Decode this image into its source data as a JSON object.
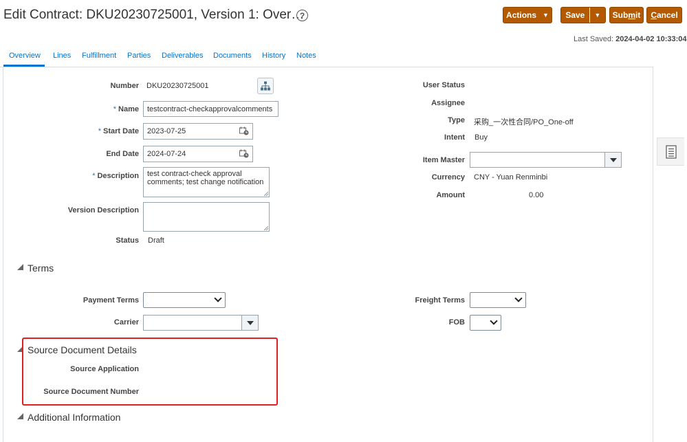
{
  "header": {
    "title": "Edit Contract: DKU20230725001, Version 1: Over…",
    "help_glyph": "?",
    "actions_label": "Actions",
    "save_label": "Save",
    "submit_prefix": "Sub",
    "submit_underlined": "m",
    "submit_suffix": "it",
    "cancel_underlined": "C",
    "cancel_suffix": "ancel",
    "last_saved_label": "Last Saved:",
    "last_saved_value": "2024-04-02 10:33:04",
    "button_color": "#b35900"
  },
  "tabs": [
    {
      "label": "Overview",
      "active": true
    },
    {
      "label": "Lines"
    },
    {
      "label": "Fulfillment"
    },
    {
      "label": "Parties"
    },
    {
      "label": "Deliverables"
    },
    {
      "label": "Documents"
    },
    {
      "label": "History"
    },
    {
      "label": "Notes"
    }
  ],
  "overview": {
    "number_label": "Number",
    "number_value": "DKU20230725001",
    "name_label": "Name",
    "name_value": "testcontract-checkapprovalcomments",
    "start_date_label": "Start Date",
    "start_date_value": "2023-07-25",
    "end_date_label": "End Date",
    "end_date_value": "2024-07-24",
    "description_label": "Description",
    "description_value": "test contract-check approval comments; test change notification",
    "version_description_label": "Version Description",
    "version_description_value": "",
    "status_label": "Status",
    "status_value": "Draft",
    "required_mark": "*",
    "user_status_label": "User Status",
    "assignee_label": "Assignee",
    "type_label": "Type",
    "type_value": "采购_一次性合同/PO_One-off",
    "intent_label": "Intent",
    "intent_value": "Buy",
    "item_master_label": "Item Master",
    "item_master_value": "",
    "currency_label": "Currency",
    "currency_value": "CNY - Yuan Renminbi",
    "amount_label": "Amount",
    "amount_value": "0.00"
  },
  "terms": {
    "heading": "Terms",
    "payment_terms_label": "Payment Terms",
    "payment_terms_value": "",
    "carrier_label": "Carrier",
    "carrier_value": "",
    "freight_terms_label": "Freight Terms",
    "freight_terms_value": "",
    "fob_label": "FOB",
    "fob_value": ""
  },
  "source_document": {
    "heading": "Source Document Details",
    "source_application_label": "Source Application",
    "source_document_number_label": "Source Document Number",
    "highlight_color": "#e02020"
  },
  "additional_info": {
    "heading": "Additional Information"
  },
  "icons": {
    "help": "help-icon",
    "hierarchy": "hierarchy-icon",
    "calendar": "calendar-icon",
    "dropdown": "chevron-down-icon",
    "side_panel": "document-list-icon"
  }
}
